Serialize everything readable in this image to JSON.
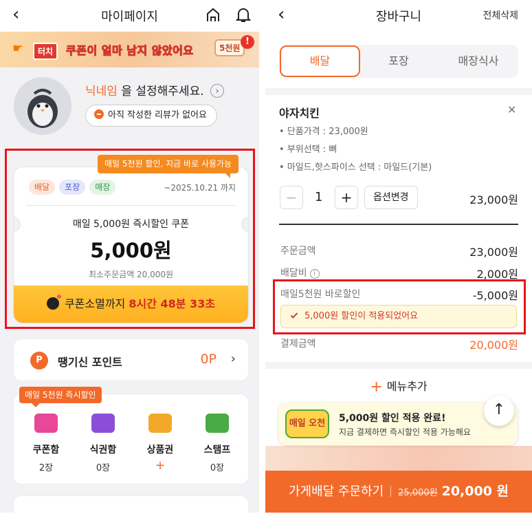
{
  "left": {
    "header": {
      "title": "마이페이지"
    },
    "banner": {
      "touch_tag": "터치",
      "text": "쿠폰이 얼마 남지 않았어요",
      "tag": "5천원",
      "alert": "!"
    },
    "profile": {
      "nickname": "닉네임",
      "prompt": " 을 설정해주세요.",
      "review_text": "아직 작성한 리뷰가 없어요"
    },
    "coupon": {
      "tooltip": "매일 5천원 할인, 지금 바로 사용가능",
      "chips": [
        "배달",
        "포장",
        "매장"
      ],
      "expiry": "~2025.10.21 까지",
      "name": "매일 5,000원 즉시할인 쿠폰",
      "amount": "5,000원",
      "min_order": "최소주문금액 20,000원",
      "countdown_label": "쿠폰소멸까지",
      "countdown_value": "8시간 48분 33초"
    },
    "points": {
      "badge": "P",
      "label": "땡기신 포인트",
      "value": "0P",
      "arrow": "›"
    },
    "menu": {
      "tip": "매일 5천원 즉시할인",
      "items": [
        {
          "name": "쿠폰함",
          "count": "2장",
          "color": "#e8479a"
        },
        {
          "name": "식권함",
          "count": "0장",
          "color": "#8a4fd6"
        },
        {
          "name": "상품권",
          "count": "+",
          "color": "#f2a92a"
        },
        {
          "name": "스탬프",
          "count": "0장",
          "color": "#4aaa45"
        }
      ]
    }
  },
  "right": {
    "header": {
      "title": "장바구니",
      "clear": "전체삭제"
    },
    "tabs": [
      "배달",
      "포장",
      "매장식사"
    ],
    "item": {
      "name": "야자치킨",
      "options": [
        "• 단품가격 : 23,000원",
        "• 부위선택 : 뼈",
        "• 마일드,핫스파이스 선택 : 마일드(기본)"
      ],
      "qty": "1",
      "option_button": "옵션변경",
      "price": "23,000원"
    },
    "summary": {
      "order_label": "주문금액",
      "order_value": "23,000원",
      "delivery_label": "배달비",
      "delivery_value": "2,000원",
      "discount_label": "매일5천원 바로할인",
      "discount_value": "-5,000원",
      "applied_text": "5,000원 할인이 적용되었어요",
      "total_label": "결제금액",
      "total_value": "20,000원"
    },
    "add_menu": "메뉴추가",
    "toast": {
      "logo": "매일 오천원",
      "title": "5,000원 할인 적용 완료!",
      "subtitle": "지금 결제하면 즉시할인 적용 가능해요"
    },
    "order": {
      "label": "가게배달 주문하기",
      "original": "25,000원",
      "final": "20,000 원"
    }
  },
  "colors": {
    "accent": "#f26a2a",
    "highlight_box": "#e8141c",
    "coupon_bar": "#ffb11f"
  }
}
